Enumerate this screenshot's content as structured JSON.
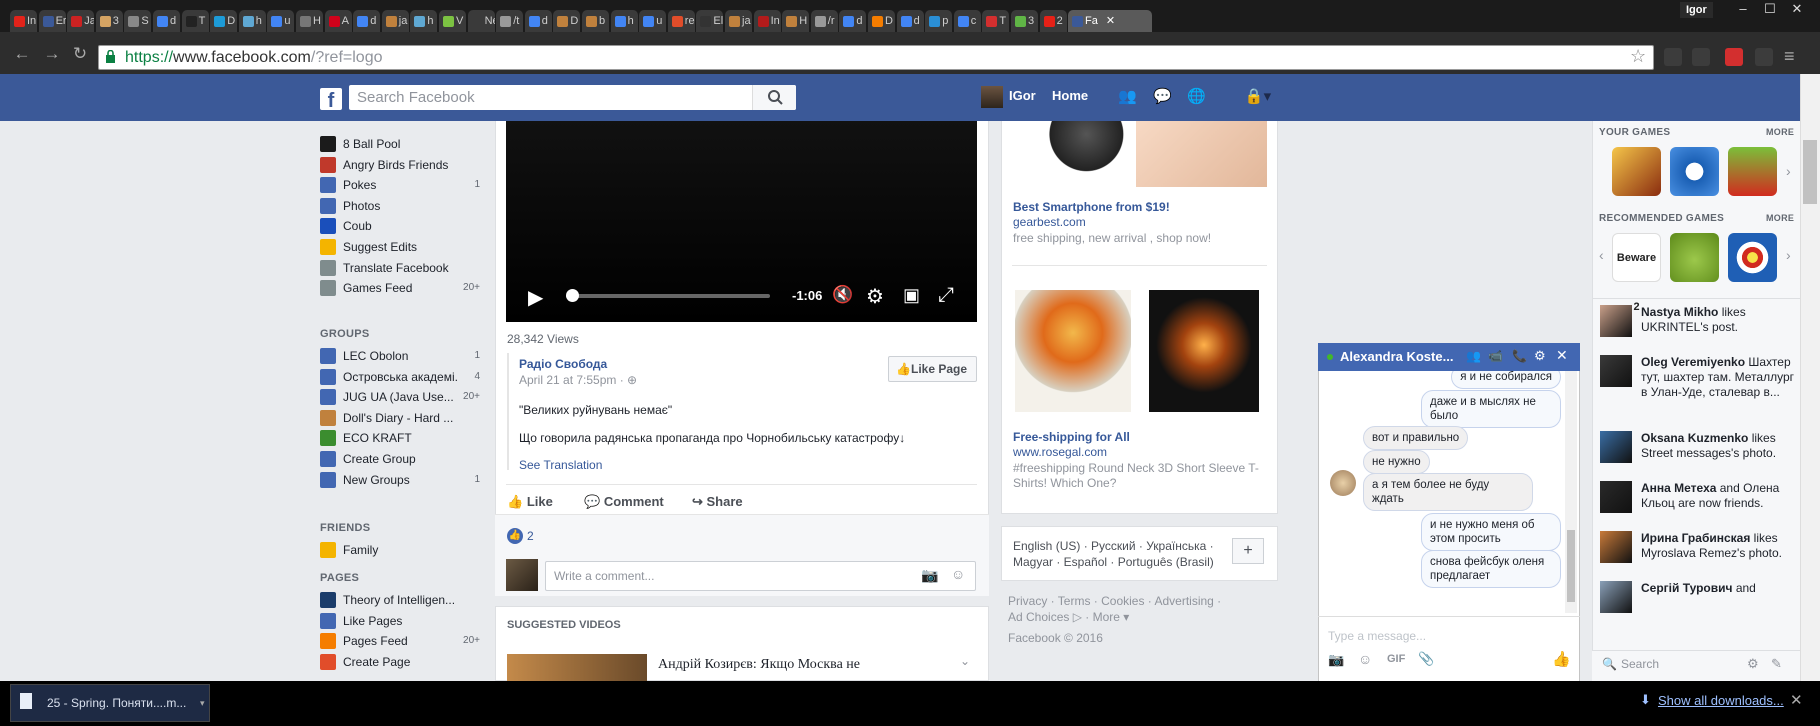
{
  "browser": {
    "tabs": [
      {
        "label": "In",
        "color": "#e2231a"
      },
      {
        "label": "Er",
        "color": "#3b5998"
      },
      {
        "label": "Ja",
        "color": "#cc2222"
      },
      {
        "label": "3",
        "color": "#d6a463"
      },
      {
        "label": "S",
        "color": "#888888"
      },
      {
        "label": "d",
        "color": "#4285f4"
      },
      {
        "label": "T",
        "color": "#222222"
      },
      {
        "label": "D",
        "color": "#1d9bd7"
      },
      {
        "label": "h",
        "color": "#5fa8d3"
      },
      {
        "label": "u",
        "color": "#4285f4"
      },
      {
        "label": "H",
        "color": "#777777"
      },
      {
        "label": "A",
        "color": "#d0021b"
      },
      {
        "label": "d",
        "color": "#4285f4"
      },
      {
        "label": "ja",
        "color": "#c0813d"
      },
      {
        "label": "h",
        "color": "#5fa8d3"
      },
      {
        "label": "V",
        "color": "#7cc242"
      },
      {
        "label": "New",
        "color": "#3a3a3a"
      },
      {
        "label": "/t",
        "color": "#999999"
      },
      {
        "label": "d",
        "color": "#4285f4"
      },
      {
        "label": "D",
        "color": "#c0813d"
      },
      {
        "label": "b",
        "color": "#c0813d"
      },
      {
        "label": "h",
        "color": "#4285f4"
      },
      {
        "label": "u",
        "color": "#4285f4"
      },
      {
        "label": "re",
        "color": "#e14d2a"
      },
      {
        "label": "El",
        "color": "#333333"
      },
      {
        "label": "ja",
        "color": "#c0813d"
      },
      {
        "label": "In",
        "color": "#b31b1b"
      },
      {
        "label": "H",
        "color": "#c0813d"
      },
      {
        "label": "/r",
        "color": "#999999"
      },
      {
        "label": "d",
        "color": "#4285f4"
      },
      {
        "label": "D",
        "color": "#f57d00"
      },
      {
        "label": "d",
        "color": "#4285f4"
      },
      {
        "label": "p",
        "color": "#2a8fd6"
      },
      {
        "label": "c",
        "color": "#4285f4"
      },
      {
        "label": "T",
        "color": "#d32f2f"
      },
      {
        "label": "3",
        "color": "#60b546"
      },
      {
        "label": "2",
        "color": "#e62117"
      }
    ],
    "active_tab": {
      "label": "Fa",
      "color": "#3b5998"
    },
    "user": "Igor",
    "url_secure": "https://",
    "url_host": "www.facebook.com",
    "url_path": "/?ref=logo"
  },
  "fb": {
    "search_placeholder": "Search Facebook",
    "me_name": "IGor",
    "home": "Home"
  },
  "leftnav": {
    "apps": [
      {
        "label": "8 Ball Pool",
        "count": "",
        "color": "#1b1b1b"
      },
      {
        "label": "Angry Birds Friends",
        "count": "",
        "color": "#c0392b"
      },
      {
        "label": "Pokes",
        "count": "1",
        "color": "#4267b2"
      },
      {
        "label": "Photos",
        "count": "",
        "color": "#4267b2"
      },
      {
        "label": "Coub",
        "count": "",
        "color": "#1a4fbb"
      },
      {
        "label": "Suggest Edits",
        "count": "",
        "color": "#f4b400"
      },
      {
        "label": "Translate Facebook",
        "count": "",
        "color": "#7f8c8d"
      },
      {
        "label": "Games Feed",
        "count": "20+",
        "color": "#7f8c8d"
      }
    ],
    "groups_head": "GROUPS",
    "groups": [
      {
        "label": "LEC Obolon",
        "count": "1",
        "color": "#4267b2"
      },
      {
        "label": "Островська академі...",
        "count": "4",
        "color": "#4267b2"
      },
      {
        "label": "JUG UA (Java Use...",
        "count": "20+",
        "color": "#4267b2"
      },
      {
        "label": "Doll's Diary - Hard ...",
        "count": "",
        "color": "#c0813d"
      },
      {
        "label": "ECO KRAFT",
        "count": "",
        "color": "#3b8d2f"
      },
      {
        "label": "Create Group",
        "count": "",
        "color": "#4267b2"
      },
      {
        "label": "New Groups",
        "count": "1",
        "color": "#4267b2"
      }
    ],
    "friends_head": "FRIENDS",
    "friends": [
      {
        "label": "Family",
        "count": "",
        "color": "#f4b400"
      }
    ],
    "pages_head": "PAGES",
    "pages": [
      {
        "label": "Theory of Intelligen...",
        "count": "",
        "color": "#1b3d6b"
      },
      {
        "label": "Like Pages",
        "count": "",
        "color": "#4267b2"
      },
      {
        "label": "Pages Feed",
        "count": "20+",
        "color": "#f57d00"
      },
      {
        "label": "Create Page",
        "count": "",
        "color": "#e14d2a"
      }
    ]
  },
  "post": {
    "video_time": "-1:06",
    "video_progress": 0.03,
    "views": "28,342 Views",
    "page_name": "Радіо Свобода",
    "date": "April 21 at 7:55pm",
    "like_page": "Like Page",
    "quote": "\"Великих руйнувань немає\"",
    "body": "Що говорила радянська пропаганда про Чорнобильську катастрофу↓",
    "see_translation": "See Translation",
    "like": "Like",
    "comment": "Comment",
    "share": "Share",
    "likes_count": "2",
    "comment_placeholder": "Write a comment...",
    "suggested_head": "SUGGESTED VIDEOS",
    "suggested_title": "Андрій Козирєв: Якщо Москва не"
  },
  "ads": [
    {
      "title": "Best Smartphone from $19!",
      "host": "gearbest.com",
      "desc": "free shipping, new arrival , shop now!"
    },
    {
      "title": "Free-shipping for All",
      "host": "www.rosegal.com",
      "desc": "#freeshipping Round Neck 3D Short Sleeve T-Shirts! Which One?"
    }
  ],
  "languages": {
    "line1": "English (US) · Русский · Українська ·",
    "line2": "Magyar · Español · Português (Brasil)",
    "plus": "+"
  },
  "footer": {
    "line1": "Privacy · Terms · Cookies · Advertising ·",
    "line2": "Ad Choices ▷ · More ▾",
    "copyright": "Facebook © 2016"
  },
  "chat": {
    "name": "Alexandra Koste...",
    "messages": [
      {
        "text": "я и не собирался",
        "me": true
      },
      {
        "text": "даже и в мыслях не было",
        "me": true
      },
      {
        "text": "вот и правильно",
        "me": false
      },
      {
        "text": "не нужно",
        "me": false
      },
      {
        "text": "а я тем более не буду ждать",
        "me": false
      },
      {
        "text": "и не нужно меня об этом просить",
        "me": true
      },
      {
        "text": "снова фейсбук оленя предлагает",
        "me": true
      }
    ],
    "input_placeholder": "Type a message...",
    "gif": "GIF"
  },
  "rail": {
    "your_games": "YOUR GAMES",
    "more1": "MORE",
    "recommended": "RECOMMENDED GAMES",
    "more2": "MORE",
    "beware": "Beware 2",
    "ticker": [
      {
        "name": "Nastya Mikho",
        "rest": " likes UKRINTEL's post."
      },
      {
        "name": "Oleg Veremiyenko",
        "rest": " Шахтер тут, шахтер там. Металлург в Улан-Уде, сталевар в..."
      },
      {
        "name": "Oksana Kuzmenko",
        "rest": " likes Street messages's photo."
      },
      {
        "name": "Анна Метеха",
        "rest": " and Олена Кльоц are now friends."
      },
      {
        "name": "Ирина Грабинская",
        "rest": " likes Myroslava Remez's photo."
      },
      {
        "name": "Сергій Турович",
        "rest": " and"
      }
    ],
    "search_placeholder": "Search"
  },
  "downloads": {
    "item": "25 - Spring. Поняти....m...",
    "show_all": "Show all downloads..."
  },
  "colors": {
    "fb_blue": "#3b5998",
    "chat_blue": "#4267b2",
    "link": "#365899"
  }
}
